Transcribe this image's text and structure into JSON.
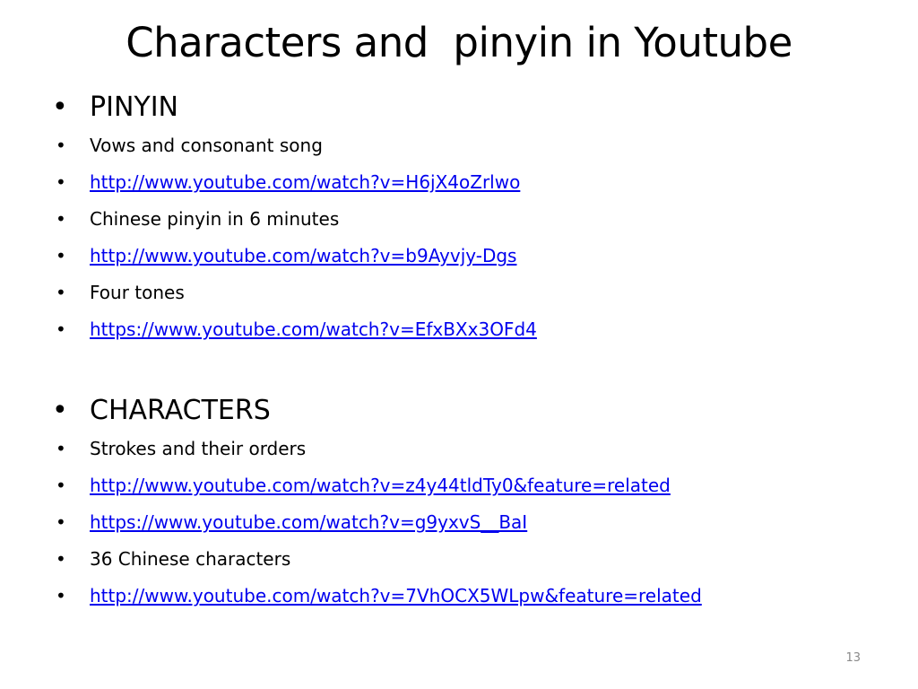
{
  "slide": {
    "title": "Characters and  pinyin in Youtube",
    "page_number": "13"
  },
  "bullets": [
    {
      "level": 1,
      "text": "PINYIN",
      "link": false
    },
    {
      "level": 2,
      "text": "Vows and consonant song",
      "link": false
    },
    {
      "level": 2,
      "text": "http://www.youtube.com/watch?v=H6jX4oZrlwo",
      "link": true
    },
    {
      "level": 2,
      "text": "Chinese pinyin in 6 minutes",
      "link": false
    },
    {
      "level": 2,
      "text": "http://www.youtube.com/watch?v=b9Ayvjy-Dgs",
      "link": true
    },
    {
      "level": 2,
      "text": "Four tones",
      "link": false
    },
    {
      "level": 2,
      "text": "https://www.youtube.com/watch?v=EfxBXx3OFd4",
      "link": true
    },
    {
      "level": 1,
      "text": "CHARACTERS",
      "link": false
    },
    {
      "level": 2,
      "text": "Strokes and their orders",
      "link": false
    },
    {
      "level": 2,
      "text": "http://www.youtube.com/watch?v=z4y44tldTy0&feature=related",
      "link": true
    },
    {
      "level": 2,
      "text": "https://www.youtube.com/watch?v=g9yxvS__BaI",
      "link": true
    },
    {
      "level": 2,
      "text": "36 Chinese characters",
      "link": false
    },
    {
      "level": 2,
      "text": "http://www.youtube.com/watch?v=7VhOCX5WLpw&feature=related",
      "link": true
    }
  ],
  "colors": {
    "link": "#0000ee",
    "text": "#000000",
    "page_number": "#8a8a8a"
  }
}
